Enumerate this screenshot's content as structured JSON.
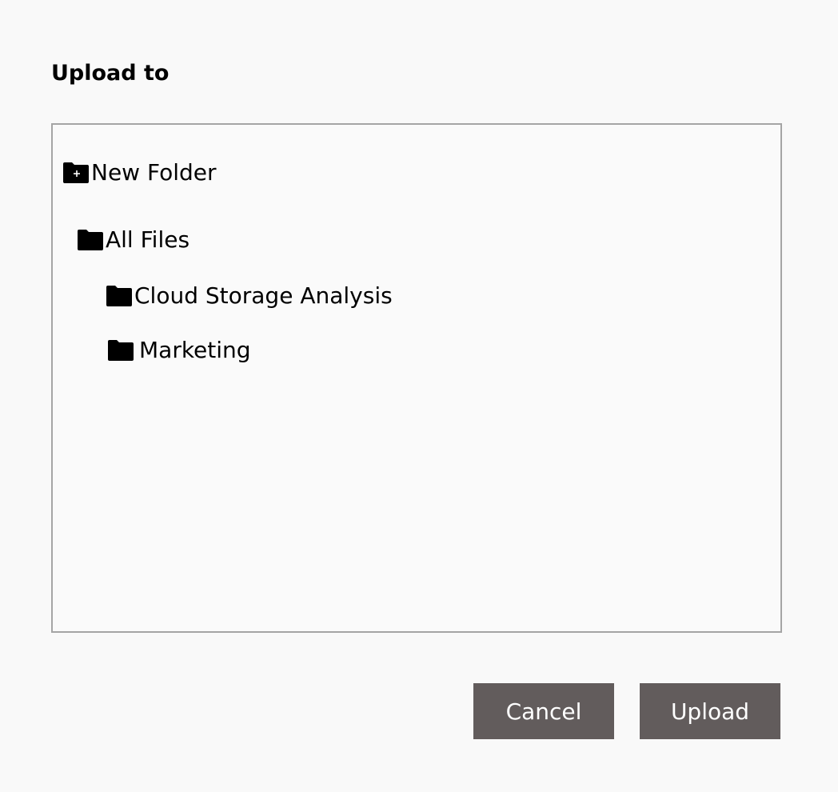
{
  "dialog": {
    "title": "Upload to"
  },
  "tree": {
    "new_folder": {
      "label": "New Folder",
      "icon": "folder-plus-icon"
    },
    "items": [
      {
        "label": "All Files",
        "icon": "folder-icon",
        "depth": 0
      },
      {
        "label": "Cloud Storage Analysis",
        "icon": "folder-icon",
        "depth": 1
      },
      {
        "label": "Marketing",
        "icon": "folder-icon",
        "depth": 1
      }
    ]
  },
  "buttons": {
    "cancel_label": "Cancel",
    "upload_label": "Upload"
  },
  "colors": {
    "background": "#f9f9f9",
    "tree_border": "#a5a5a5",
    "button_bg": "#625c5c",
    "button_text": "#ffffff"
  }
}
